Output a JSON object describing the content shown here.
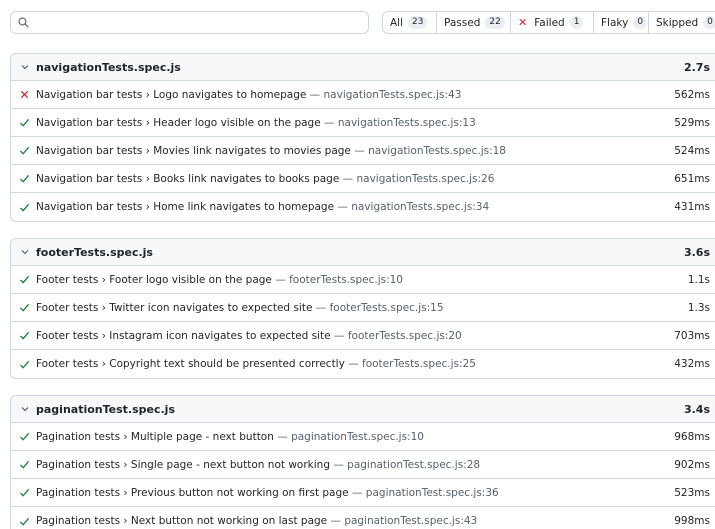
{
  "search": {
    "placeholder": "",
    "value": ""
  },
  "filters": [
    {
      "label": "All",
      "count": "23"
    },
    {
      "label": "Passed",
      "count": "22"
    },
    {
      "label": "Failed",
      "count": "1"
    },
    {
      "label": "Flaky",
      "count": "0"
    },
    {
      "label": "Skipped",
      "count": "0"
    }
  ],
  "colors": {
    "pass": "#1a7f37",
    "fail": "#cf222e",
    "border": "#d0d7de",
    "header_bg": "#f6f8fa"
  },
  "files": [
    {
      "name": "navigationTests.spec.js",
      "duration": "2.7s",
      "tests": [
        {
          "status": "failed",
          "title": "Navigation bar tests › Logo navigates to homepage",
          "location": "— navigationTests.spec.js:43",
          "duration": "562ms"
        },
        {
          "status": "passed",
          "title": "Navigation bar tests › Header logo visible on the page",
          "location": "— navigationTests.spec.js:13",
          "duration": "529ms"
        },
        {
          "status": "passed",
          "title": "Navigation bar tests › Movies link navigates to movies page",
          "location": "— navigationTests.spec.js:18",
          "duration": "524ms"
        },
        {
          "status": "passed",
          "title": "Navigation bar tests › Books link navigates to books page",
          "location": "— navigationTests.spec.js:26",
          "duration": "651ms"
        },
        {
          "status": "passed",
          "title": "Navigation bar tests › Home link navigates to homepage",
          "location": "— navigationTests.spec.js:34",
          "duration": "431ms"
        }
      ]
    },
    {
      "name": "footerTests.spec.js",
      "duration": "3.6s",
      "tests": [
        {
          "status": "passed",
          "title": "Footer tests › Footer logo visible on the page",
          "location": "— footerTests.spec.js:10",
          "duration": "1.1s"
        },
        {
          "status": "passed",
          "title": "Footer tests › Twitter icon navigates to expected site",
          "location": "— footerTests.spec.js:15",
          "duration": "1.3s"
        },
        {
          "status": "passed",
          "title": "Footer tests › Instagram icon navigates to expected site",
          "location": "— footerTests.spec.js:20",
          "duration": "703ms"
        },
        {
          "status": "passed",
          "title": "Footer tests › Copyright text should be presented correctly",
          "location": "— footerTests.spec.js:25",
          "duration": "432ms"
        }
      ]
    },
    {
      "name": "paginationTest.spec.js",
      "duration": "3.4s",
      "tests": [
        {
          "status": "passed",
          "title": "Pagination tests › Multiple page - next button",
          "location": "— paginationTest.spec.js:10",
          "duration": "968ms"
        },
        {
          "status": "passed",
          "title": "Pagination tests › Single page - next button not working",
          "location": "— paginationTest.spec.js:28",
          "duration": "902ms"
        },
        {
          "status": "passed",
          "title": "Pagination tests › Previous button not working on first page",
          "location": "— paginationTest.spec.js:36",
          "duration": "523ms"
        },
        {
          "status": "passed",
          "title": "Pagination tests › Next button not working on last page",
          "location": "— paginationTest.spec.js:43",
          "duration": "998ms"
        }
      ]
    }
  ]
}
